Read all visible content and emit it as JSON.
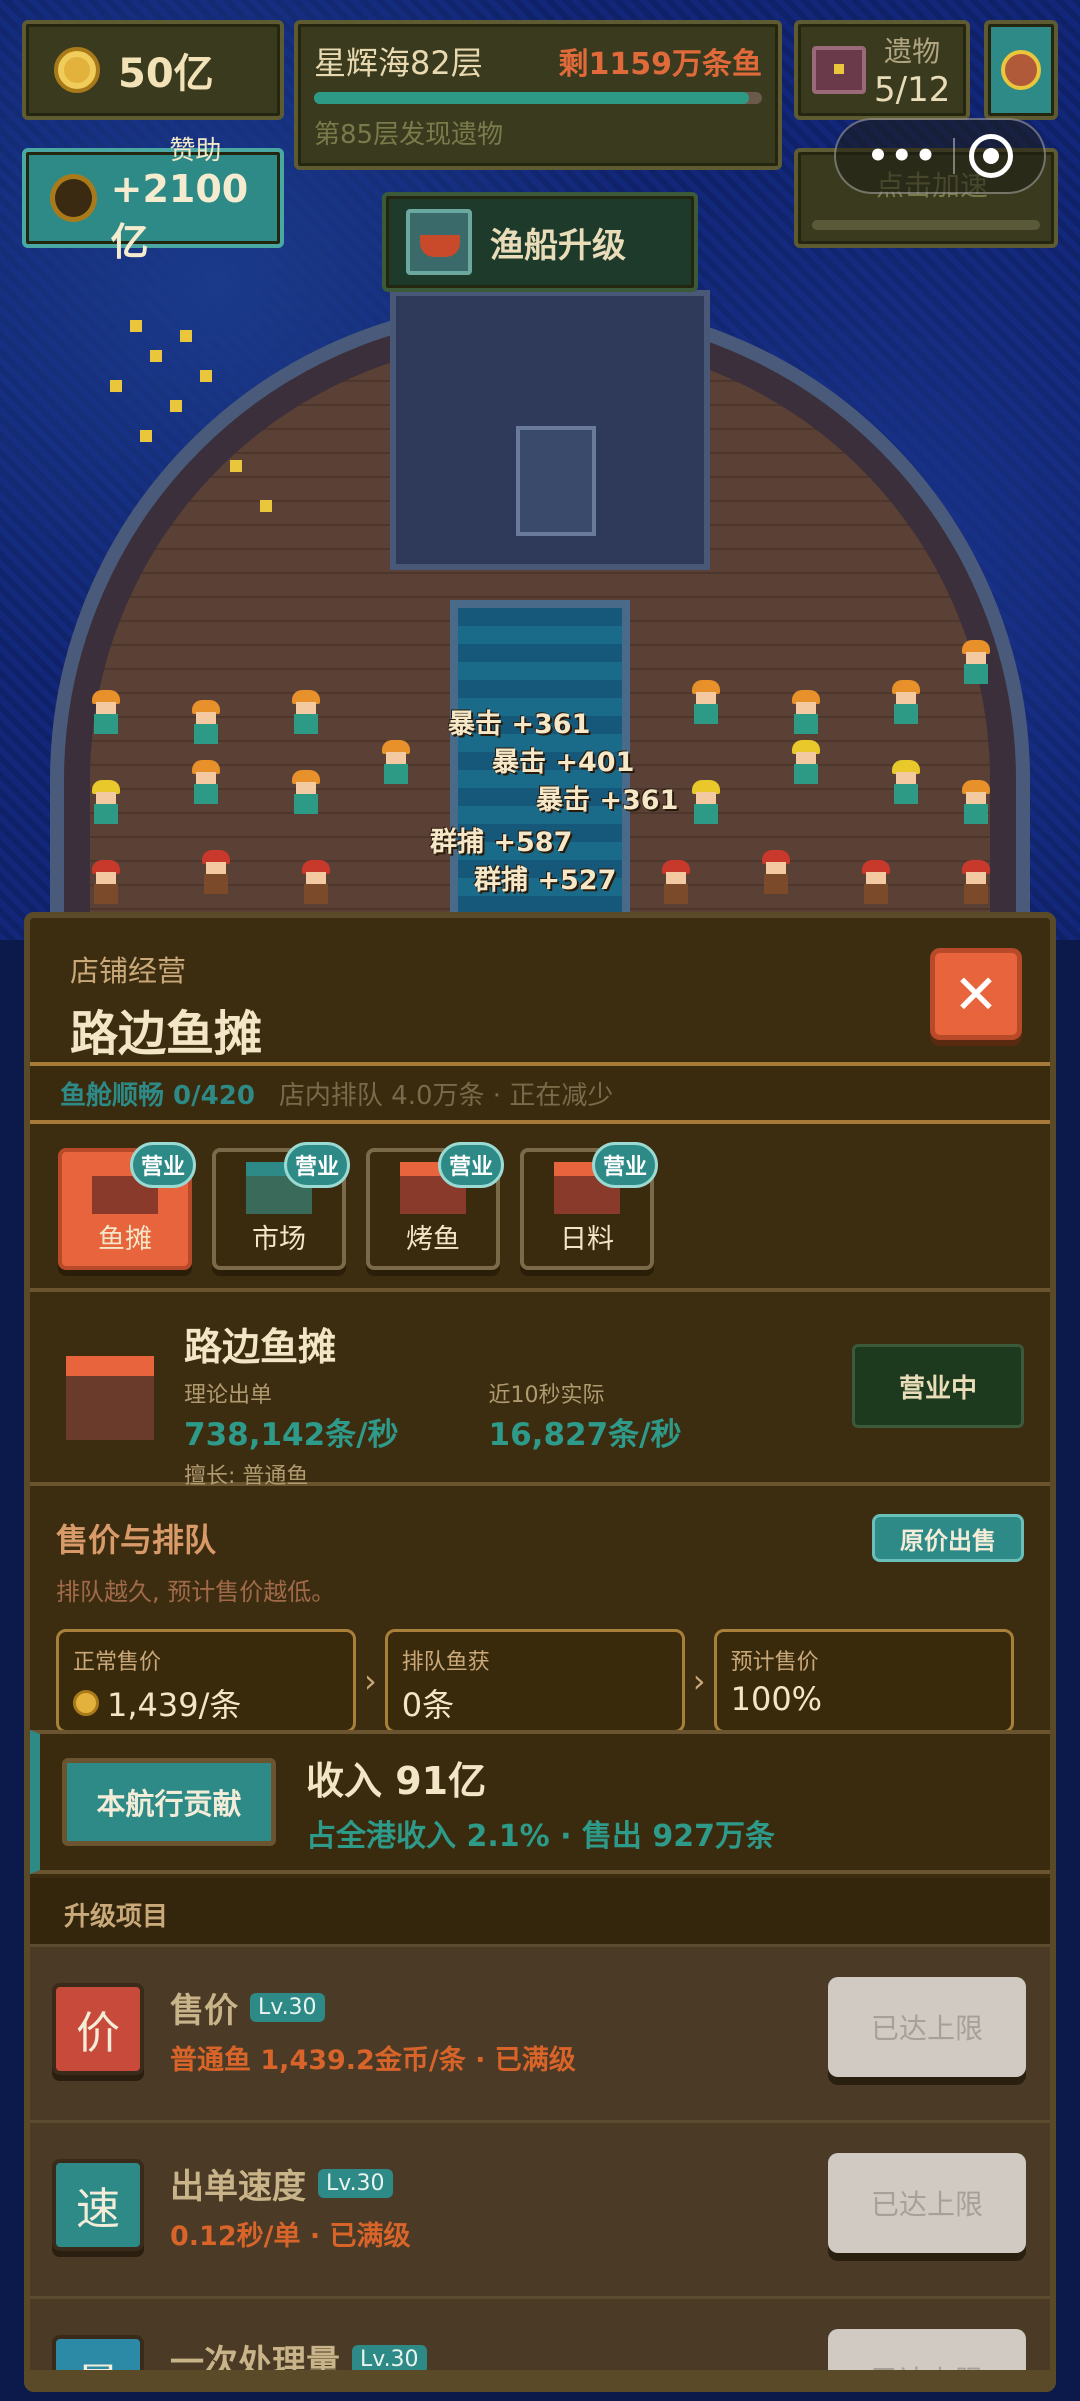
{
  "hud": {
    "gold": "50亿",
    "sea_title": "星辉海82层",
    "sea_remaining": "剩1159万条鱼",
    "sea_progress": 0.97,
    "sea_note": "第85层发现遗物",
    "relic_label": "遗物",
    "relic_count": "5/12",
    "sponsor_label": "赞助",
    "sponsor_value": "+2100亿",
    "ship_upgrade_label": "渔船升级",
    "boost_label": "点击加速",
    "capsule_dots": "•••"
  },
  "float_texts": [
    "暴击 +361",
    "暴击 +401",
    "暴击 +361",
    "群捕 +587",
    "群捕 +527"
  ],
  "panel": {
    "subtitle": "店铺经营",
    "title": "路边鱼摊",
    "close": "✕",
    "status_flow": "鱼舱顺畅 0/420",
    "status_queue": "店内排队 4.0万条 · 正在减少",
    "tabs": [
      {
        "label": "鱼摊",
        "badge": "营业"
      },
      {
        "label": "市场",
        "badge": "营业"
      },
      {
        "label": "烤鱼",
        "badge": "营业"
      },
      {
        "label": "日料",
        "badge": "营业"
      }
    ],
    "shop": {
      "name": "路边鱼摊",
      "theory_label": "理论出单",
      "theory_value": "738,142条/秒",
      "actual_label": "近10秒实际",
      "actual_value": "16,827条/秒",
      "skill": "擅长: 普通鱼",
      "open_button": "营业中"
    },
    "price": {
      "title": "售价与排队",
      "orig_button": "原价出售",
      "note": "排队越久, 预计售价越低。",
      "normal_label": "正常售价",
      "normal_value": "1,439/条",
      "queue_label": "排队鱼获",
      "queue_value": "0条",
      "expected_label": "预计售价",
      "expected_value": "100%"
    },
    "contrib": {
      "button": "本航行贡献",
      "income": "收入 91亿",
      "detail": "占全港收入 2.1% · 售出 927万条"
    },
    "upgrades_title": "升级项目",
    "upgrades": [
      {
        "icon_char": "价",
        "name": "售价",
        "level": "Lv.30",
        "desc": "普通鱼 1,439.2金币/条 · 已满级",
        "button": "已达上限"
      },
      {
        "icon_char": "速",
        "name": "出单速度",
        "level": "Lv.30",
        "desc": "0.12秒/单 · 已满级",
        "button": "已达上限"
      },
      {
        "icon_char": "量",
        "name": "一次处理量",
        "level": "Lv.30",
        "desc": "",
        "button": "已达上限"
      }
    ]
  }
}
